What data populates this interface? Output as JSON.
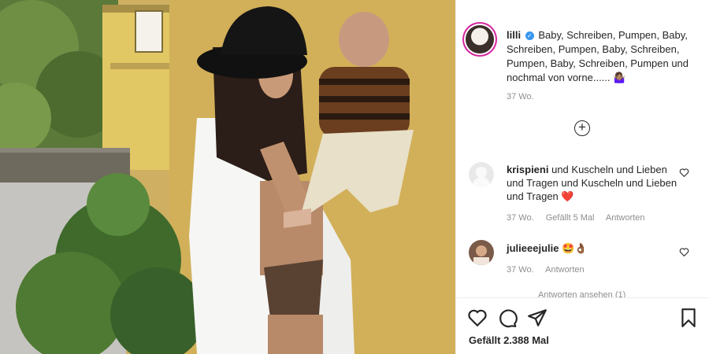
{
  "post": {
    "username": "lilli",
    "caption": "Baby, Schreiben, Pumpen, Baby, Schreiben, Pumpen, Baby, Schreiben, Pumpen, Baby, Schreiben, Pumpen und nochmal von vorne......",
    "caption_emoji": "🤷🏽‍♀️",
    "time": "37 Wo.",
    "likes": "Gefällt 2.388 Mal"
  },
  "comments": [
    {
      "username": "krispieni",
      "text": "und Kuscheln und Lieben und Tragen und Kuscheln und Lieben und Tragen",
      "emoji": "❤️",
      "time": "37 Wo.",
      "likes": "Gefällt 5 Mal",
      "reply": "Antworten"
    },
    {
      "username": "julieeejulie",
      "text": "",
      "emoji": "🤩👌🏾",
      "time": "37 Wo.",
      "reply": "Antworten"
    }
  ],
  "view_replies": "Antworten ansehen (1)",
  "icons": [
    "verified-icon",
    "load-more-icon",
    "heart-icon",
    "comment-icon",
    "share-icon",
    "save-icon"
  ],
  "colors": {
    "verified": "#3897f0",
    "meta": "#8e8e8e",
    "text": "#262626",
    "story_ring": "#d6249f"
  }
}
